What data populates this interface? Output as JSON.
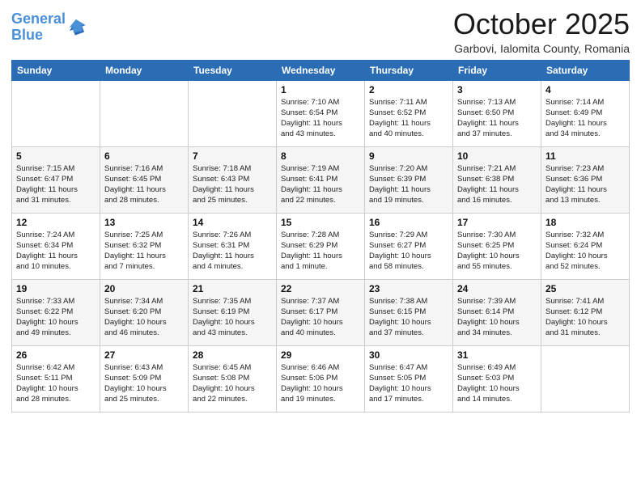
{
  "header": {
    "logo_line1": "General",
    "logo_line2": "Blue",
    "month": "October 2025",
    "location": "Garbovi, Ialomita County, Romania"
  },
  "days_of_week": [
    "Sunday",
    "Monday",
    "Tuesday",
    "Wednesday",
    "Thursday",
    "Friday",
    "Saturday"
  ],
  "weeks": [
    [
      {
        "day": "",
        "info": ""
      },
      {
        "day": "",
        "info": ""
      },
      {
        "day": "",
        "info": ""
      },
      {
        "day": "1",
        "info": "Sunrise: 7:10 AM\nSunset: 6:54 PM\nDaylight: 11 hours\nand 43 minutes."
      },
      {
        "day": "2",
        "info": "Sunrise: 7:11 AM\nSunset: 6:52 PM\nDaylight: 11 hours\nand 40 minutes."
      },
      {
        "day": "3",
        "info": "Sunrise: 7:13 AM\nSunset: 6:50 PM\nDaylight: 11 hours\nand 37 minutes."
      },
      {
        "day": "4",
        "info": "Sunrise: 7:14 AM\nSunset: 6:49 PM\nDaylight: 11 hours\nand 34 minutes."
      }
    ],
    [
      {
        "day": "5",
        "info": "Sunrise: 7:15 AM\nSunset: 6:47 PM\nDaylight: 11 hours\nand 31 minutes."
      },
      {
        "day": "6",
        "info": "Sunrise: 7:16 AM\nSunset: 6:45 PM\nDaylight: 11 hours\nand 28 minutes."
      },
      {
        "day": "7",
        "info": "Sunrise: 7:18 AM\nSunset: 6:43 PM\nDaylight: 11 hours\nand 25 minutes."
      },
      {
        "day": "8",
        "info": "Sunrise: 7:19 AM\nSunset: 6:41 PM\nDaylight: 11 hours\nand 22 minutes."
      },
      {
        "day": "9",
        "info": "Sunrise: 7:20 AM\nSunset: 6:39 PM\nDaylight: 11 hours\nand 19 minutes."
      },
      {
        "day": "10",
        "info": "Sunrise: 7:21 AM\nSunset: 6:38 PM\nDaylight: 11 hours\nand 16 minutes."
      },
      {
        "day": "11",
        "info": "Sunrise: 7:23 AM\nSunset: 6:36 PM\nDaylight: 11 hours\nand 13 minutes."
      }
    ],
    [
      {
        "day": "12",
        "info": "Sunrise: 7:24 AM\nSunset: 6:34 PM\nDaylight: 11 hours\nand 10 minutes."
      },
      {
        "day": "13",
        "info": "Sunrise: 7:25 AM\nSunset: 6:32 PM\nDaylight: 11 hours\nand 7 minutes."
      },
      {
        "day": "14",
        "info": "Sunrise: 7:26 AM\nSunset: 6:31 PM\nDaylight: 11 hours\nand 4 minutes."
      },
      {
        "day": "15",
        "info": "Sunrise: 7:28 AM\nSunset: 6:29 PM\nDaylight: 11 hours\nand 1 minute."
      },
      {
        "day": "16",
        "info": "Sunrise: 7:29 AM\nSunset: 6:27 PM\nDaylight: 10 hours\nand 58 minutes."
      },
      {
        "day": "17",
        "info": "Sunrise: 7:30 AM\nSunset: 6:25 PM\nDaylight: 10 hours\nand 55 minutes."
      },
      {
        "day": "18",
        "info": "Sunrise: 7:32 AM\nSunset: 6:24 PM\nDaylight: 10 hours\nand 52 minutes."
      }
    ],
    [
      {
        "day": "19",
        "info": "Sunrise: 7:33 AM\nSunset: 6:22 PM\nDaylight: 10 hours\nand 49 minutes."
      },
      {
        "day": "20",
        "info": "Sunrise: 7:34 AM\nSunset: 6:20 PM\nDaylight: 10 hours\nand 46 minutes."
      },
      {
        "day": "21",
        "info": "Sunrise: 7:35 AM\nSunset: 6:19 PM\nDaylight: 10 hours\nand 43 minutes."
      },
      {
        "day": "22",
        "info": "Sunrise: 7:37 AM\nSunset: 6:17 PM\nDaylight: 10 hours\nand 40 minutes."
      },
      {
        "day": "23",
        "info": "Sunrise: 7:38 AM\nSunset: 6:15 PM\nDaylight: 10 hours\nand 37 minutes."
      },
      {
        "day": "24",
        "info": "Sunrise: 7:39 AM\nSunset: 6:14 PM\nDaylight: 10 hours\nand 34 minutes."
      },
      {
        "day": "25",
        "info": "Sunrise: 7:41 AM\nSunset: 6:12 PM\nDaylight: 10 hours\nand 31 minutes."
      }
    ],
    [
      {
        "day": "26",
        "info": "Sunrise: 6:42 AM\nSunset: 5:11 PM\nDaylight: 10 hours\nand 28 minutes."
      },
      {
        "day": "27",
        "info": "Sunrise: 6:43 AM\nSunset: 5:09 PM\nDaylight: 10 hours\nand 25 minutes."
      },
      {
        "day": "28",
        "info": "Sunrise: 6:45 AM\nSunset: 5:08 PM\nDaylight: 10 hours\nand 22 minutes."
      },
      {
        "day": "29",
        "info": "Sunrise: 6:46 AM\nSunset: 5:06 PM\nDaylight: 10 hours\nand 19 minutes."
      },
      {
        "day": "30",
        "info": "Sunrise: 6:47 AM\nSunset: 5:05 PM\nDaylight: 10 hours\nand 17 minutes."
      },
      {
        "day": "31",
        "info": "Sunrise: 6:49 AM\nSunset: 5:03 PM\nDaylight: 10 hours\nand 14 minutes."
      },
      {
        "day": "",
        "info": ""
      }
    ]
  ]
}
